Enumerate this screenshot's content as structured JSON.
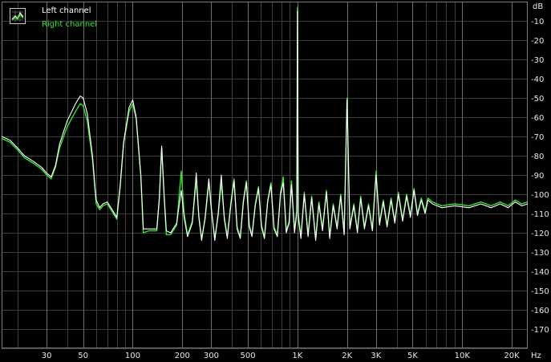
{
  "chart_data": {
    "type": "line",
    "title": "",
    "xlabel": "",
    "ylabel": "",
    "x_unit": "Hz",
    "y_unit": "dB",
    "x_scale": "log",
    "xlim": [
      16,
      25000
    ],
    "ylim": [
      -180,
      0
    ],
    "grid": true,
    "legend_position": "top-left",
    "x_ticks": [
      {
        "value": 30,
        "label": "30"
      },
      {
        "value": 50,
        "label": "50"
      },
      {
        "value": 100,
        "label": "100"
      },
      {
        "value": 200,
        "label": "200"
      },
      {
        "value": 300,
        "label": "300"
      },
      {
        "value": 500,
        "label": "500"
      },
      {
        "value": 1000,
        "label": "1K"
      },
      {
        "value": 2000,
        "label": "2K"
      },
      {
        "value": 3000,
        "label": "3K"
      },
      {
        "value": 5000,
        "label": "5K"
      },
      {
        "value": 10000,
        "label": "10K"
      },
      {
        "value": 20000,
        "label": "20K"
      }
    ],
    "y_ticks": [
      -10,
      -20,
      -30,
      -40,
      -50,
      -60,
      -70,
      -80,
      -90,
      -100,
      -110,
      -120,
      -130,
      -140,
      -150,
      -160,
      -170
    ],
    "series": [
      {
        "name": "Left channel",
        "color": "#ffffff",
        "points": [
          [
            16,
            -70
          ],
          [
            18,
            -72
          ],
          [
            20,
            -76
          ],
          [
            22,
            -80
          ],
          [
            25,
            -83
          ],
          [
            28,
            -86
          ],
          [
            30,
            -89
          ],
          [
            32,
            -91
          ],
          [
            34,
            -85
          ],
          [
            36,
            -74
          ],
          [
            40,
            -62
          ],
          [
            45,
            -53
          ],
          [
            48,
            -49
          ],
          [
            50,
            -50
          ],
          [
            53,
            -58
          ],
          [
            57,
            -80
          ],
          [
            60,
            -103
          ],
          [
            63,
            -107
          ],
          [
            66,
            -105
          ],
          [
            70,
            -104
          ],
          [
            75,
            -108
          ],
          [
            80,
            -112
          ],
          [
            84,
            -95
          ],
          [
            88,
            -73
          ],
          [
            95,
            -55
          ],
          [
            100,
            -51
          ],
          [
            105,
            -60
          ],
          [
            112,
            -90
          ],
          [
            116,
            -118
          ],
          [
            125,
            -118
          ],
          [
            140,
            -118
          ],
          [
            145,
            -102
          ],
          [
            150,
            -75
          ],
          [
            155,
            -100
          ],
          [
            160,
            -119
          ],
          [
            170,
            -120
          ],
          [
            185,
            -115
          ],
          [
            197,
            -98
          ],
          [
            205,
            -112
          ],
          [
            215,
            -122
          ],
          [
            230,
            -115
          ],
          [
            243,
            -89
          ],
          [
            252,
            -112
          ],
          [
            262,
            -124
          ],
          [
            275,
            -112
          ],
          [
            290,
            -92
          ],
          [
            300,
            -107
          ],
          [
            315,
            -124
          ],
          [
            330,
            -110
          ],
          [
            345,
            -90
          ],
          [
            360,
            -113
          ],
          [
            375,
            -123
          ],
          [
            395,
            -105
          ],
          [
            412,
            -93
          ],
          [
            430,
            -118
          ],
          [
            450,
            -123
          ],
          [
            470,
            -104
          ],
          [
            490,
            -94
          ],
          [
            510,
            -117
          ],
          [
            530,
            -122
          ],
          [
            555,
            -106
          ],
          [
            580,
            -97
          ],
          [
            605,
            -117
          ],
          [
            630,
            -123
          ],
          [
            660,
            -104
          ],
          [
            690,
            -95
          ],
          [
            720,
            -118
          ],
          [
            755,
            -122
          ],
          [
            790,
            -100
          ],
          [
            820,
            -94
          ],
          [
            855,
            -120
          ],
          [
            890,
            -115
          ],
          [
            920,
            -95
          ],
          [
            960,
            -120
          ],
          [
            990,
            -110
          ],
          [
            1000,
            -5
          ],
          [
            1010,
            -112
          ],
          [
            1050,
            -123
          ],
          [
            1100,
            -100
          ],
          [
            1160,
            -122
          ],
          [
            1220,
            -102
          ],
          [
            1290,
            -124
          ],
          [
            1350,
            -105
          ],
          [
            1420,
            -119
          ],
          [
            1500,
            -99
          ],
          [
            1570,
            -123
          ],
          [
            1650,
            -106
          ],
          [
            1740,
            -118
          ],
          [
            1830,
            -101
          ],
          [
            1920,
            -121
          ],
          [
            2000,
            -51
          ],
          [
            2080,
            -118
          ],
          [
            2200,
            -106
          ],
          [
            2310,
            -120
          ],
          [
            2420,
            -102
          ],
          [
            2550,
            -118
          ],
          [
            2700,
            -106
          ],
          [
            2850,
            -119
          ],
          [
            3000,
            -90
          ],
          [
            3150,
            -116
          ],
          [
            3320,
            -104
          ],
          [
            3500,
            -117
          ],
          [
            3700,
            -103
          ],
          [
            3900,
            -115
          ],
          [
            4100,
            -100
          ],
          [
            4350,
            -114
          ],
          [
            4600,
            -101
          ],
          [
            4850,
            -112
          ],
          [
            5100,
            -98
          ],
          [
            5350,
            -111
          ],
          [
            5650,
            -103
          ],
          [
            5950,
            -110
          ],
          [
            6200,
            -103
          ],
          [
            6600,
            -105
          ],
          [
            7500,
            -107
          ],
          [
            9000,
            -106
          ],
          [
            11000,
            -107
          ],
          [
            13000,
            -105
          ],
          [
            15000,
            -107
          ],
          [
            17000,
            -105
          ],
          [
            19000,
            -107
          ],
          [
            21000,
            -104
          ],
          [
            23000,
            -106
          ],
          [
            25000,
            -105
          ]
        ]
      },
      {
        "name": "Right channel",
        "color": "#33e433",
        "points": [
          [
            16,
            -71
          ],
          [
            18,
            -73
          ],
          [
            20,
            -77
          ],
          [
            22,
            -81
          ],
          [
            25,
            -84
          ],
          [
            28,
            -87
          ],
          [
            30,
            -90
          ],
          [
            32,
            -92
          ],
          [
            34,
            -86
          ],
          [
            36,
            -76
          ],
          [
            40,
            -65
          ],
          [
            45,
            -57
          ],
          [
            48,
            -53
          ],
          [
            50,
            -54
          ],
          [
            53,
            -62
          ],
          [
            57,
            -82
          ],
          [
            60,
            -105
          ],
          [
            63,
            -108
          ],
          [
            66,
            -106
          ],
          [
            70,
            -105
          ],
          [
            75,
            -109
          ],
          [
            80,
            -113
          ],
          [
            84,
            -96
          ],
          [
            88,
            -74
          ],
          [
            95,
            -57
          ],
          [
            100,
            -53
          ],
          [
            105,
            -61
          ],
          [
            112,
            -91
          ],
          [
            116,
            -120
          ],
          [
            125,
            -119
          ],
          [
            140,
            -119
          ],
          [
            145,
            -103
          ],
          [
            150,
            -76
          ],
          [
            155,
            -101
          ],
          [
            160,
            -121
          ],
          [
            170,
            -121
          ],
          [
            185,
            -116
          ],
          [
            197,
            -88
          ],
          [
            205,
            -110
          ],
          [
            215,
            -121
          ],
          [
            230,
            -114
          ],
          [
            243,
            -93
          ],
          [
            252,
            -111
          ],
          [
            262,
            -123
          ],
          [
            275,
            -113
          ],
          [
            290,
            -94
          ],
          [
            300,
            -108
          ],
          [
            315,
            -123
          ],
          [
            330,
            -111
          ],
          [
            345,
            -94
          ],
          [
            360,
            -112
          ],
          [
            375,
            -122
          ],
          [
            395,
            -104
          ],
          [
            412,
            -92
          ],
          [
            430,
            -117
          ],
          [
            450,
            -122
          ],
          [
            470,
            -103
          ],
          [
            490,
            -93
          ],
          [
            510,
            -116
          ],
          [
            530,
            -121
          ],
          [
            555,
            -105
          ],
          [
            580,
            -96
          ],
          [
            605,
            -116
          ],
          [
            630,
            -122
          ],
          [
            660,
            -103
          ],
          [
            690,
            -94
          ],
          [
            720,
            -117
          ],
          [
            755,
            -121
          ],
          [
            790,
            -99
          ],
          [
            820,
            -91
          ],
          [
            855,
            -119
          ],
          [
            890,
            -114
          ],
          [
            920,
            -93
          ],
          [
            960,
            -119
          ],
          [
            990,
            -108
          ],
          [
            1000,
            -3
          ],
          [
            1010,
            -110
          ],
          [
            1050,
            -122
          ],
          [
            1100,
            -99
          ],
          [
            1160,
            -121
          ],
          [
            1220,
            -101
          ],
          [
            1290,
            -123
          ],
          [
            1350,
            -104
          ],
          [
            1420,
            -118
          ],
          [
            1500,
            -98
          ],
          [
            1570,
            -122
          ],
          [
            1650,
            -105
          ],
          [
            1740,
            -117
          ],
          [
            1830,
            -100
          ],
          [
            1920,
            -120
          ],
          [
            2000,
            -50
          ],
          [
            2080,
            -117
          ],
          [
            2200,
            -105
          ],
          [
            2310,
            -119
          ],
          [
            2420,
            -101
          ],
          [
            2550,
            -117
          ],
          [
            2700,
            -105
          ],
          [
            2850,
            -118
          ],
          [
            3000,
            -88
          ],
          [
            3150,
            -115
          ],
          [
            3320,
            -103
          ],
          [
            3500,
            -116
          ],
          [
            3700,
            -102
          ],
          [
            3900,
            -114
          ],
          [
            4100,
            -99
          ],
          [
            4350,
            -113
          ],
          [
            4600,
            -100
          ],
          [
            4850,
            -111
          ],
          [
            5100,
            -97
          ],
          [
            5350,
            -110
          ],
          [
            5650,
            -102
          ],
          [
            5950,
            -109
          ],
          [
            6200,
            -102
          ],
          [
            6600,
            -104
          ],
          [
            7500,
            -106
          ],
          [
            9000,
            -105
          ],
          [
            11000,
            -106
          ],
          [
            13000,
            -104
          ],
          [
            15000,
            -106
          ],
          [
            17000,
            -104
          ],
          [
            19000,
            -106
          ],
          [
            21000,
            -103
          ],
          [
            23000,
            -105
          ],
          [
            25000,
            -104
          ]
        ]
      }
    ]
  }
}
